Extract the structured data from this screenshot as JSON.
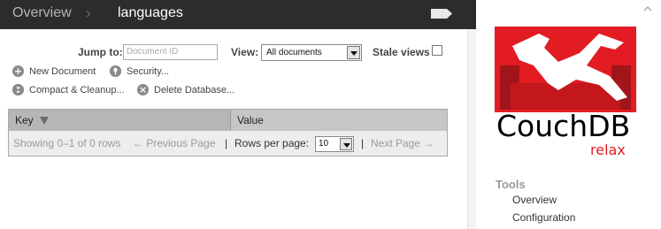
{
  "topbar": {
    "crumb_overview": "Overview",
    "crumb_separator": "›",
    "crumb_current": "languages"
  },
  "toolbar": {
    "jump_to_label": "Jump to:",
    "doc_id_placeholder": "Document ID",
    "view_label": "View:",
    "view_selected": "All documents",
    "stale_views_label": "Stale views",
    "stale_views_checked": false,
    "actions": {
      "new_document": "New Document",
      "security": "Security...",
      "compact_cleanup": "Compact & Cleanup...",
      "delete_database": "Delete Database..."
    }
  },
  "table": {
    "columns": [
      "Key",
      "Value"
    ],
    "footer": {
      "showing": "Showing 0–1 of 0 rows",
      "prev": "← Previous Page",
      "sep": "|",
      "rows_per_page_label": "Rows per page:",
      "rows_per_page_value": "10",
      "next": "Next Page →"
    }
  },
  "sidebar": {
    "logo_text": "CouchDB",
    "logo_subtext": "relax",
    "tools_heading": "Tools",
    "tools_items": [
      "Overview",
      "Configuration"
    ]
  },
  "colors": {
    "topbar_bg": "#2c2c2c",
    "logo_red": "#e21c22",
    "header_gray": "#c6c6c6"
  }
}
